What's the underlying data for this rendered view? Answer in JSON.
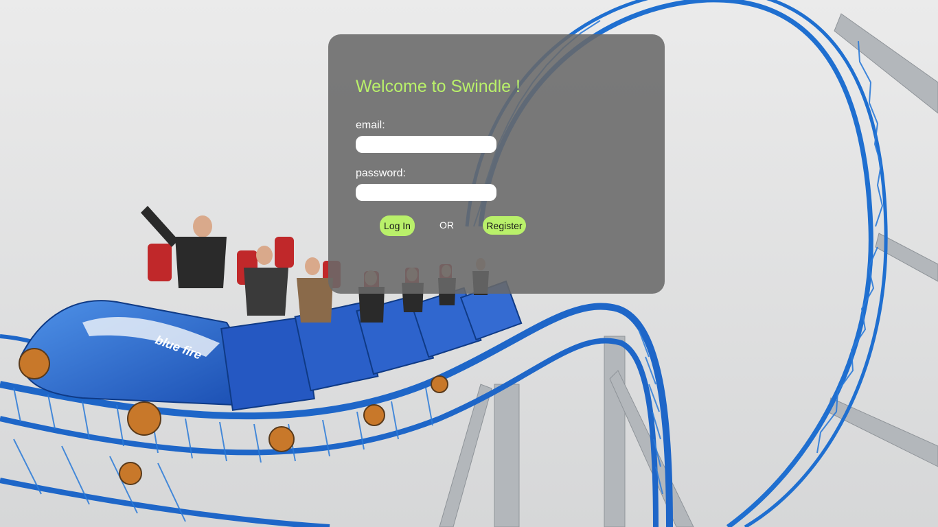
{
  "login": {
    "title": "Welcome to Swindle !",
    "email_label": "email:",
    "email_value": "",
    "password_label": "password:",
    "password_value": "",
    "login_button": "Log In",
    "or_text": "OR",
    "register_button": "Register"
  },
  "background": {
    "car_logo": "blue fire"
  },
  "colors": {
    "accent": "#b9f06a",
    "panel": "#696969",
    "track_blue": "#1f6fd0",
    "support_gray": "#b8bcc0"
  }
}
